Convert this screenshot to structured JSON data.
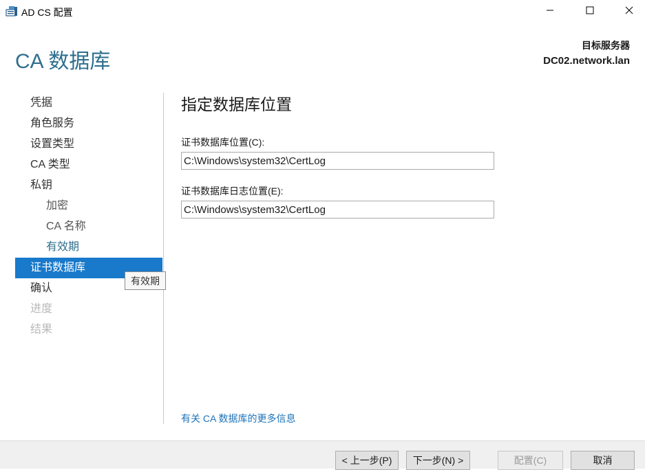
{
  "window": {
    "title": "AD CS 配置",
    "minimize_icon": "minimize-icon",
    "maximize_icon": "maximize-icon",
    "close_icon": "close-icon"
  },
  "header": {
    "page_title": "CA 数据库",
    "server_label": "目标服务器",
    "server_name": "DC02.network.lan"
  },
  "nav": {
    "items": [
      {
        "label": "凭据",
        "state": "passed"
      },
      {
        "label": "角色服务",
        "state": "passed"
      },
      {
        "label": "设置类型",
        "state": "passed"
      },
      {
        "label": "CA 类型",
        "state": "passed"
      },
      {
        "label": "私钥",
        "state": "passed"
      },
      {
        "label": "加密",
        "state": "passed-sub"
      },
      {
        "label": "CA 名称",
        "state": "passed-sub"
      },
      {
        "label": "有效期",
        "state": "visited-last"
      },
      {
        "label": "证书数据库",
        "state": "active"
      },
      {
        "label": "确认",
        "state": "passed"
      },
      {
        "label": "进度",
        "state": "disabled"
      },
      {
        "label": "结果",
        "state": "disabled"
      }
    ]
  },
  "tooltip": {
    "text": "有效期"
  },
  "main": {
    "heading": "指定数据库位置",
    "db_location_label": "证书数据库位置(C):",
    "db_location_value": "C:\\Windows\\system32\\CertLog",
    "log_location_label": "证书数据库日志位置(E):",
    "log_location_value": "C:\\Windows\\system32\\CertLog",
    "more_info_link": "有关 CA 数据库的更多信息"
  },
  "footer": {
    "prev_label": "< 上一步(P)",
    "next_label": "下一步(N) >",
    "configure_label": "配置(C)",
    "cancel_label": "取消"
  },
  "colors": {
    "accent": "#1979ca",
    "heading": "#2e6f8e",
    "link": "#1e73b8",
    "disabled_text": "#b8b8b8"
  }
}
